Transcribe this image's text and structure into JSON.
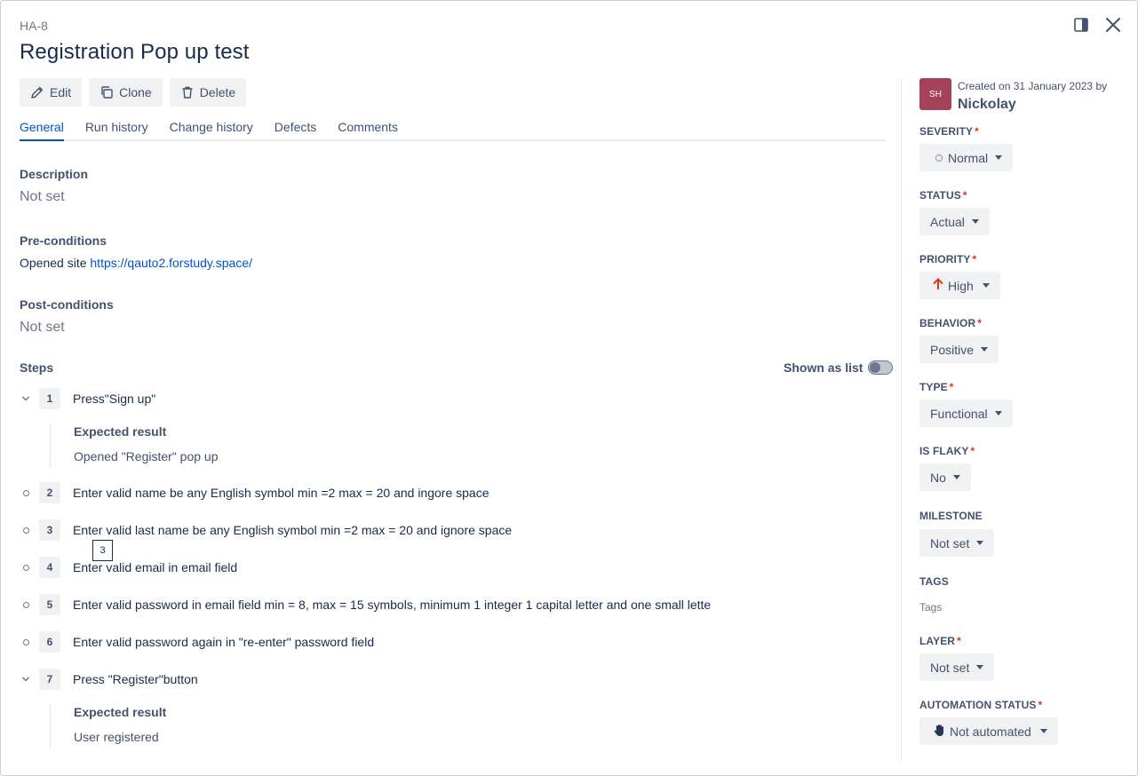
{
  "header": {
    "issue_key": "HA-8",
    "title": "Registration Pop up test"
  },
  "toolbar": {
    "edit_label": "Edit",
    "clone_label": "Clone",
    "delete_label": "Delete"
  },
  "tabs": [
    {
      "label": "General",
      "active": true
    },
    {
      "label": "Run history",
      "active": false
    },
    {
      "label": "Change history",
      "active": false
    },
    {
      "label": "Defects",
      "active": false
    },
    {
      "label": "Comments",
      "active": false
    }
  ],
  "general": {
    "description_label": "Description",
    "description_value": "Not set",
    "preconditions_label": "Pre-conditions",
    "preconditions_text": "Opened site",
    "preconditions_link": "https://qauto2.forstudy.space/",
    "postconditions_label": "Post-conditions",
    "postconditions_value": "Not set",
    "steps_label": "Steps",
    "shown_as_list_label": "Shown as list"
  },
  "steps": [
    {
      "num": "1",
      "text": "Press\"Sign up\"",
      "expanded": true,
      "expected_label": "Expected result",
      "expected_value": "Opened \"Register\" pop up"
    },
    {
      "num": "2",
      "text": "Enter valid name be any English symbol min =2 max = 20 and ingore space",
      "expanded": false
    },
    {
      "num": "3",
      "text": "Enter valid last name be any English symbol min =2 max = 20 and ignore space",
      "expanded": false
    },
    {
      "num": "4",
      "text": "Enter valid email in email field",
      "expanded": false
    },
    {
      "num": "5",
      "text": "Enter valid password in email field min = 8, max = 15 symbols, minimum 1 integer 1 capital letter and one small lette",
      "expanded": false
    },
    {
      "num": "6",
      "text": "Enter valid password again in \"re-enter\" password field",
      "expanded": false
    },
    {
      "num": "7",
      "text": "Press \"Register\"button",
      "expanded": true,
      "expected_label": "Expected result",
      "expected_value": "User registered"
    }
  ],
  "tooltip": {
    "text": "3"
  },
  "sidebar": {
    "avatar_initials": "SH",
    "created_text": "Created on 31 January 2023 by",
    "creator": "Nickolay",
    "severity_label": "SEVERITY",
    "severity_value": "Normal",
    "status_label": "STATUS",
    "status_value": "Actual",
    "priority_label": "PRIORITY",
    "priority_value": "High",
    "behavior_label": "BEHAVIOR",
    "behavior_value": "Positive",
    "type_label": "TYPE",
    "type_value": "Functional",
    "is_flaky_label": "IS FLAKY",
    "is_flaky_value": "No",
    "milestone_label": "MILESTONE",
    "milestone_value": "Not set",
    "tags_label": "TAGS",
    "tags_placeholder": "Tags",
    "layer_label": "LAYER",
    "layer_value": "Not set",
    "automation_label": "AUTOMATION STATUS",
    "automation_value": "Not automated",
    "required_mark": "*"
  },
  "colors": {
    "accent": "#0052cc",
    "priority_high": "#de350b",
    "avatar_bg": "#a4425a"
  },
  "icons": {
    "panel": "panel-toggle-icon",
    "close": "close-icon",
    "edit": "pencil-icon",
    "clone": "clone-icon",
    "delete": "trash-icon",
    "priority": "arrow-up-icon",
    "automation": "hand-icon"
  }
}
